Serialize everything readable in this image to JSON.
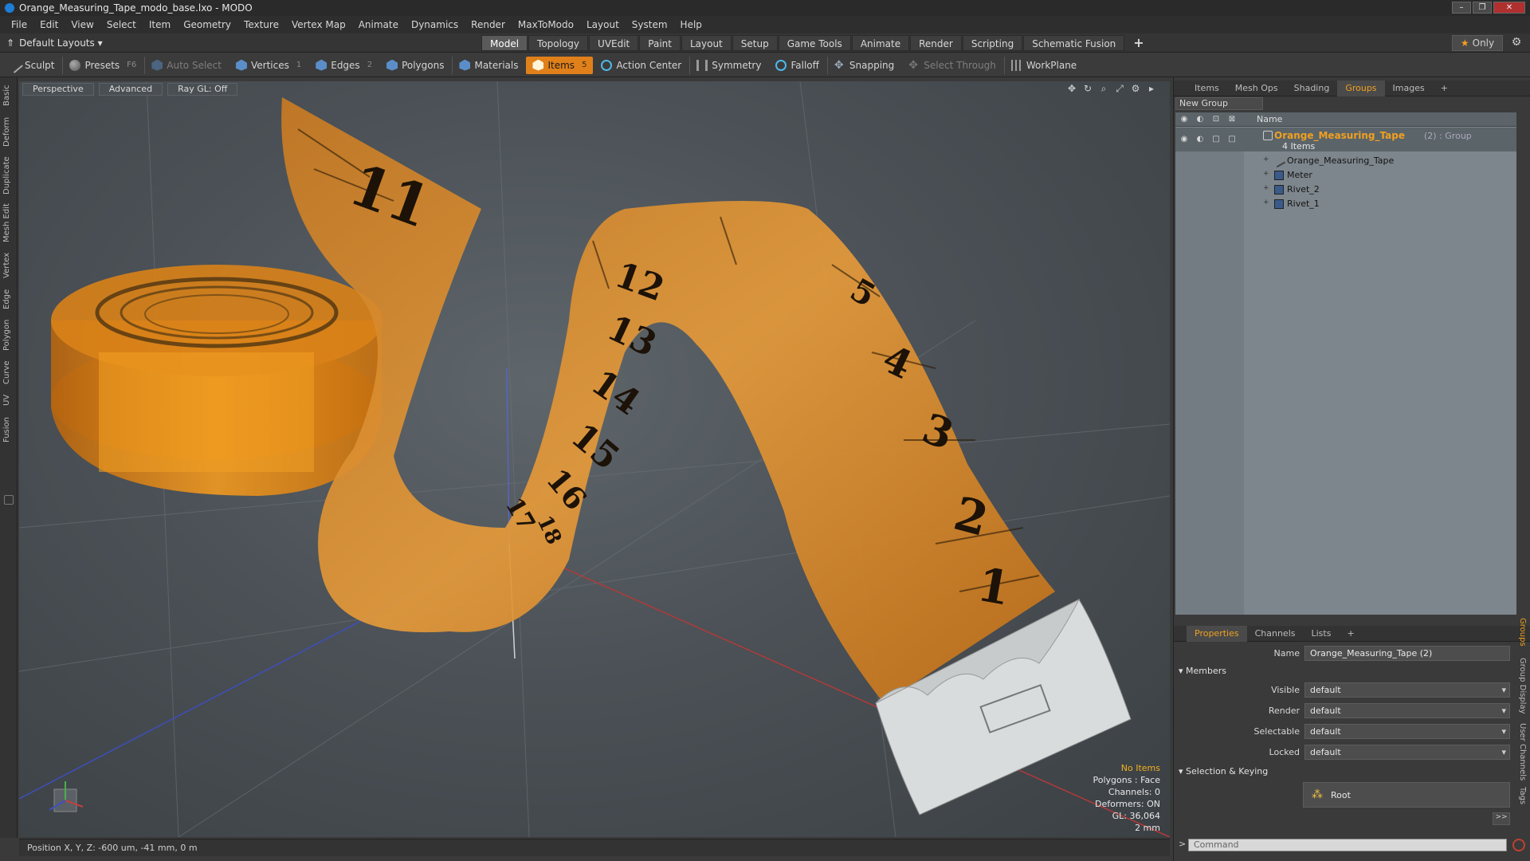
{
  "window": {
    "title": "Orange_Measuring_Tape_modo_base.lxo - MODO",
    "controls": [
      "–",
      "❐",
      "✕"
    ]
  },
  "menu": [
    "File",
    "Edit",
    "View",
    "Select",
    "Item",
    "Geometry",
    "Texture",
    "Vertex Map",
    "Animate",
    "Dynamics",
    "Render",
    "MaxToModo",
    "Layout",
    "System",
    "Help"
  ],
  "layout_selector": "Default Layouts ▾",
  "layout_tabs": [
    "Model",
    "Topology",
    "UVEdit",
    "Paint",
    "Layout",
    "Setup",
    "Game Tools",
    "Animate",
    "Render",
    "Scripting",
    "Schematic Fusion"
  ],
  "layout_active": "Model",
  "only_label": "Only",
  "toolbar": {
    "sculpt": "Sculpt",
    "presets": "Presets",
    "presets_key": "F6",
    "auto_select": "Auto Select",
    "vertices": "Vertices",
    "vertices_count": "1",
    "edges": "Edges",
    "edges_count": "2",
    "polygons": "Polygons",
    "materials": "Materials",
    "items": "Items",
    "items_count": "5",
    "action_center": "Action Center",
    "symmetry": "Symmetry",
    "falloff": "Falloff",
    "snapping": "Snapping",
    "select_through": "Select Through",
    "workplane": "WorkPlane"
  },
  "left_tabs": [
    "Basic",
    "Deform",
    "Duplicate",
    "Mesh Edit",
    "Vertex",
    "Edge",
    "Polygon",
    "Curve",
    "UV",
    "Fusion"
  ],
  "viewport": {
    "buttons": [
      "Perspective",
      "Advanced",
      "Ray GL: Off"
    ],
    "info": {
      "no_items": "No Items",
      "polygons": "Polygons : Face",
      "channels": "Channels: 0",
      "deformers": "Deformers: ON",
      "gl": "GL: 36,064",
      "scale": "2 mm"
    },
    "tape_numbers": [
      "11",
      "12",
      "13",
      "14",
      "15",
      "16",
      "17",
      "18",
      "5",
      "4",
      "3",
      "2",
      "1"
    ]
  },
  "statusbar": {
    "position": "Position X, Y, Z:  -600 um, -41 mm, 0 m"
  },
  "groups_panel": {
    "tabs": [
      "Items",
      "Mesh Ops",
      "Shading",
      "Groups",
      "Images",
      "+"
    ],
    "active_tab": "Groups",
    "new_group": "New Group",
    "name_col": "Name",
    "group": {
      "name": "Orange_Measuring_Tape",
      "suffix": "(2) : Group",
      "items": "4 Items"
    },
    "children": [
      "Orange_Measuring_Tape",
      "Meter",
      "Rivet_2",
      "Rivet_1"
    ]
  },
  "properties": {
    "tabs": [
      "Properties",
      "Channels",
      "Lists",
      "+"
    ],
    "active_tab": "Properties",
    "name_label": "Name",
    "name_value": "Orange_Measuring_Tape (2)",
    "members_label": "Members",
    "visible_label": "Visible",
    "visible_value": "default",
    "render_label": "Render",
    "render_value": "default",
    "selectable_label": "Selectable",
    "selectable_value": "default",
    "locked_label": "Locked",
    "locked_value": "default",
    "sel_keying_label": "Selection & Keying",
    "root_label": "Root",
    "more_label": ">>",
    "side_tabs": [
      "Groups",
      "Group Display",
      "User Channels",
      "Tags"
    ],
    "command_placeholder": "Command"
  },
  "colors": {
    "accent": "#f0a020",
    "tape": "#e08a2a",
    "viewport": "#4b5156"
  }
}
